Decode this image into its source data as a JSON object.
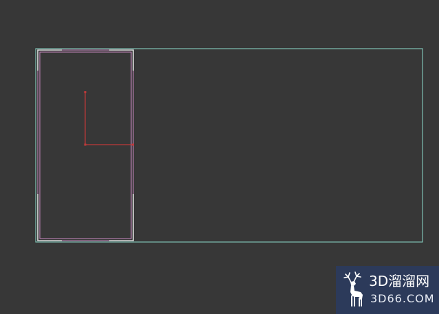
{
  "viewport": {
    "background_color": "#373737",
    "outer_rect_color": "#7fc2b4",
    "inner_rect_color": "#c98ac0",
    "corner_mark_color": "#dcdcdc",
    "axis_color": "#c03a3a"
  },
  "watermark": {
    "brand_text": "3D溜溜网",
    "url_text": "3D66.COM",
    "background_color": "#2c3a5a",
    "icon": "deer-logo-icon"
  }
}
